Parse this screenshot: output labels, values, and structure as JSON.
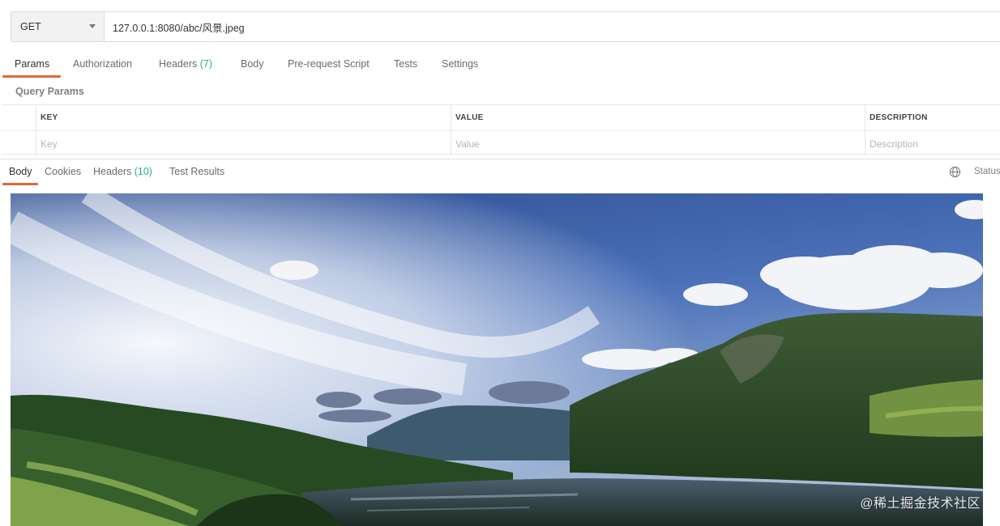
{
  "request": {
    "method": "GET",
    "url": "127.0.0.1:8080/abc/风景.jpeg"
  },
  "request_tabs": {
    "params": "Params",
    "authorization": "Authorization",
    "headers": "Headers",
    "headers_count": "(7)",
    "body": "Body",
    "pre_request": "Pre-request Script",
    "tests": "Tests",
    "settings": "Settings"
  },
  "query_params": {
    "title": "Query Params",
    "columns": [
      "KEY",
      "VALUE",
      "DESCRIPTION"
    ],
    "placeholders": [
      "Key",
      "Value",
      "Description"
    ]
  },
  "response_tabs": {
    "body": "Body",
    "cookies": "Cookies",
    "headers": "Headers",
    "headers_count": "(10)",
    "test_results": "Test Results",
    "status": "Status"
  },
  "icons": {
    "globe": "globe-icon",
    "dropdown": "chevron-down-icon"
  },
  "colors": {
    "accent": "#e5653a",
    "count_green": "#26b47f"
  },
  "response_image": {
    "watermark": "@稀土掘金技术社区"
  }
}
